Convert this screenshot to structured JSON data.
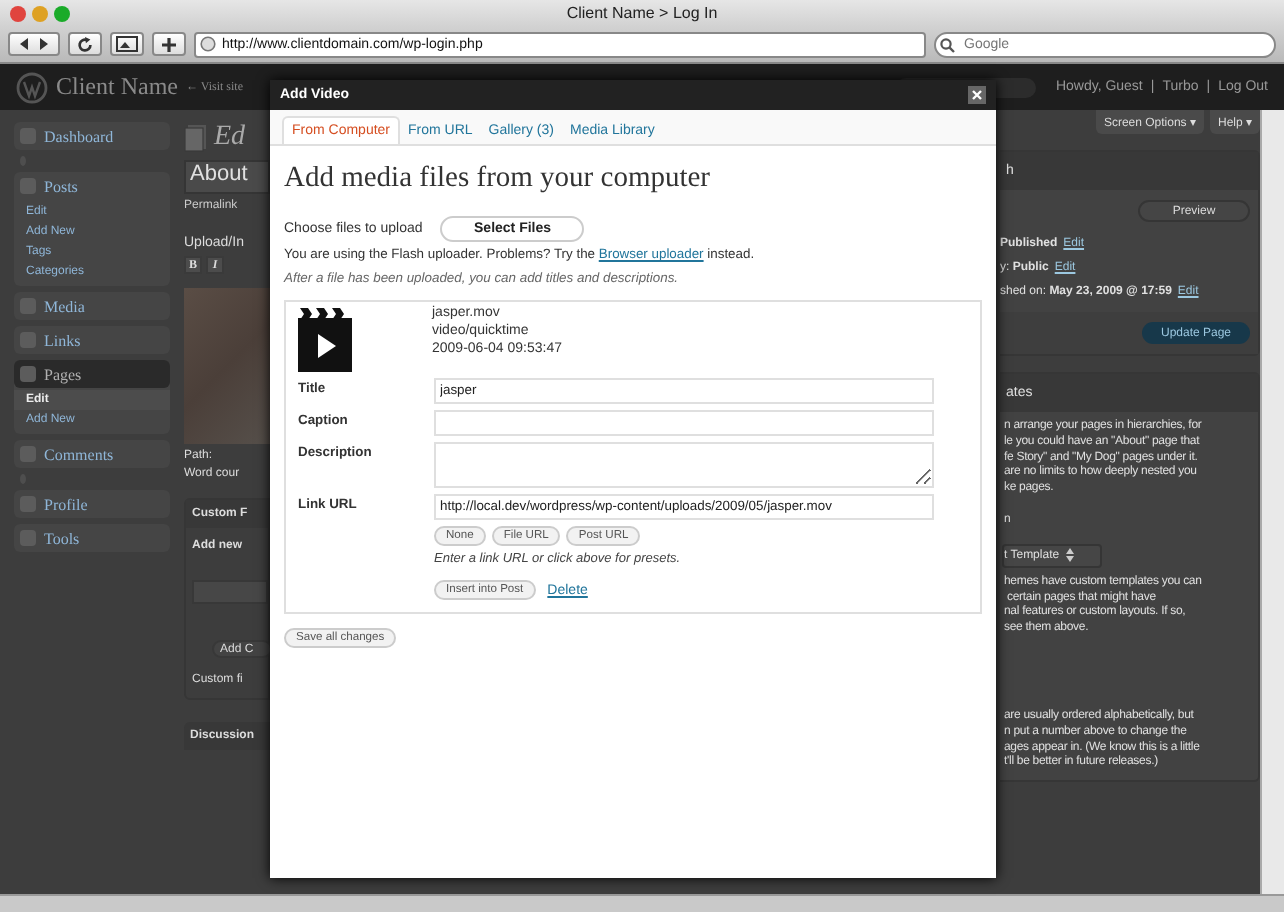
{
  "browser": {
    "title": "Client Name > Log In",
    "url": "http://www.clientdomain.com/wp-login.php",
    "search_placeholder": "Google"
  },
  "admin_header": {
    "site_name": "Client Name",
    "visit_site": "← Visit site",
    "greeting": "Howdy, Guest",
    "separator": "|",
    "user_links": [
      "Turbo",
      "Log Out"
    ]
  },
  "screen_buttons": [
    "Screen Options ▾",
    "Help ▾"
  ],
  "sidebar": {
    "items": [
      {
        "kind": "menu",
        "label": "Dashboard",
        "selected": false
      },
      {
        "kind": "separator"
      },
      {
        "kind": "menu",
        "label": "Posts",
        "selected": false,
        "children": [
          {
            "label": "Edit",
            "selected": false
          },
          {
            "label": "Add New",
            "selected": false
          },
          {
            "label": "Tags",
            "selected": false
          },
          {
            "label": "Categories",
            "selected": false
          }
        ]
      },
      {
        "kind": "menu",
        "label": "Media",
        "selected": false
      },
      {
        "kind": "menu",
        "label": "Links",
        "selected": false
      },
      {
        "kind": "menu",
        "label": "Pages",
        "selected": true,
        "children": [
          {
            "label": "Edit",
            "selected": true
          },
          {
            "label": "Add New",
            "selected": false
          }
        ]
      },
      {
        "kind": "menu",
        "label": "Comments",
        "selected": false
      },
      {
        "kind": "separator"
      },
      {
        "kind": "menu",
        "label": "Profile",
        "selected": false
      },
      {
        "kind": "menu",
        "label": "Tools",
        "selected": false
      }
    ]
  },
  "editor": {
    "heading": "Ed",
    "title_value": "About",
    "permalink": "Permalink",
    "upload": "Upload/In",
    "format_buttons": [
      "B",
      "I"
    ],
    "path": "Path:",
    "word_count": "Word cour",
    "custom_fields": "Custom F",
    "add_new": "Add new",
    "add_button": "Add C",
    "custom_note": "Custom fi",
    "discussion": "Discussion"
  },
  "publish": {
    "header": "h",
    "preview": "Preview",
    "status": [
      {
        "text": "**Published**",
        "link": "Edit"
      },
      {
        "text": "y: **Public**",
        "link": "Edit"
      },
      {
        "text": "shed on: **May 23, 2009 @ 17:59**",
        "link": "Edit"
      }
    ],
    "update": "Update Page"
  },
  "attributes": {
    "header": "ates",
    "paragraphs": [
      "n arrange your pages in hierarchies, for\nle you could have an \"About\" page that\nfe Story\" and \"My Dog\" pages under it.\nare no limits to how deeply nested you\nke pages.",
      "n"
    ],
    "template": "t Template",
    "template_note": "hemes have custom templates you can\n certain pages that might have\nnal features or custom layouts. If so,\nsee them above.",
    "order_note": "are usually ordered alphabetically, but\nn put a number above to change the\nages appear in. (We know this is a little\nt'll be better in future releases.)"
  },
  "modal": {
    "title": "Add Video",
    "tabs": [
      {
        "label": "From Computer",
        "selected": true
      },
      {
        "label": "From URL",
        "selected": false
      },
      {
        "label": "Gallery (3)",
        "selected": false
      },
      {
        "label": "Media Library",
        "selected": false
      }
    ],
    "heading": "Add media files from your computer",
    "choose_label": "Choose files to upload",
    "select_button": "Select Files",
    "flash_note": "You are using the Flash uploader. Problems? Try the",
    "flash_link": "Browser uploader",
    "flash_after": "instead.",
    "after_note": "After a file has been uploaded, you can add titles and descriptions.",
    "file": {
      "name": "jasper.mov",
      "type": "video/quicktime",
      "date": "2009-06-04 09:53:47",
      "fields": [
        {
          "kind": "input",
          "label": "Title",
          "value": "jasper"
        },
        {
          "kind": "input",
          "label": "Caption"
        },
        {
          "kind": "textarea",
          "label": "Description"
        },
        {
          "kind": "input",
          "label": "Link URL",
          "value": "http://local.dev/wordpress/wp-content/uploads/2009/05/jasper.mov"
        }
      ],
      "url_buttons": [
        "None",
        "File URL",
        "Post URL"
      ],
      "url_help": "Enter a link URL or click above for presets.",
      "insert_button": "Insert into Post",
      "delete_link": "Delete"
    },
    "save_button": "Save all changes"
  }
}
